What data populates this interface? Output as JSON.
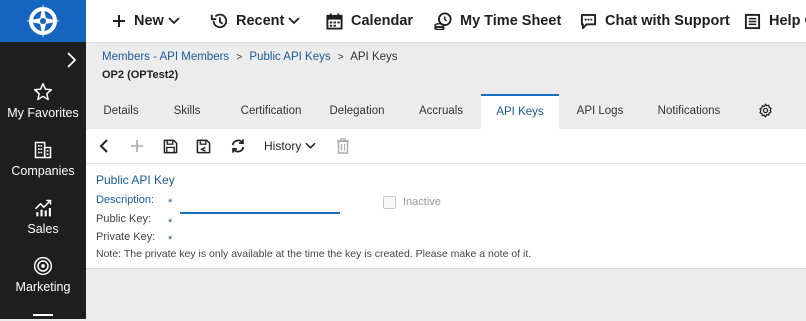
{
  "sidebar": {
    "items": [
      {
        "label": "My Favorites",
        "icon": "star-icon"
      },
      {
        "label": "Companies",
        "icon": "building-icon"
      },
      {
        "label": "Sales",
        "icon": "chart-icon"
      },
      {
        "label": "Marketing",
        "icon": "target-icon"
      }
    ]
  },
  "topbar": {
    "new_label": "New",
    "recent_label": "Recent",
    "calendar_label": "Calendar",
    "timesheet_label": "My Time Sheet",
    "chat_label": "Chat with Support",
    "help_label": "Help C"
  },
  "breadcrumb": {
    "items": [
      "Members - API Members",
      "Public API Keys"
    ],
    "current": "API Keys",
    "separator": ">"
  },
  "page_title": "OP2 (OPTest2)",
  "tabs": [
    "Details",
    "Skills",
    "Certification",
    "Delegation",
    "Accruals",
    "API Keys",
    "API Logs",
    "Notifications"
  ],
  "active_tab": "API Keys",
  "toolbar": {
    "history_label": "History"
  },
  "form": {
    "section_title": "Public API Key",
    "description_label": "Description:",
    "public_key_label": "Public Key:",
    "private_key_label": "Private Key:",
    "required_mark": "*",
    "description_value": "",
    "inactive_label": "Inactive",
    "inactive_checked": false,
    "note": "Note: The private key is only available at the time the key is created. Please make a note of it."
  },
  "colors": {
    "brand_blue": "#1565c0",
    "sidebar_bg": "#1e1e1e",
    "link_blue": "#1a5a9a",
    "accent_blue": "#1a6fc4"
  }
}
